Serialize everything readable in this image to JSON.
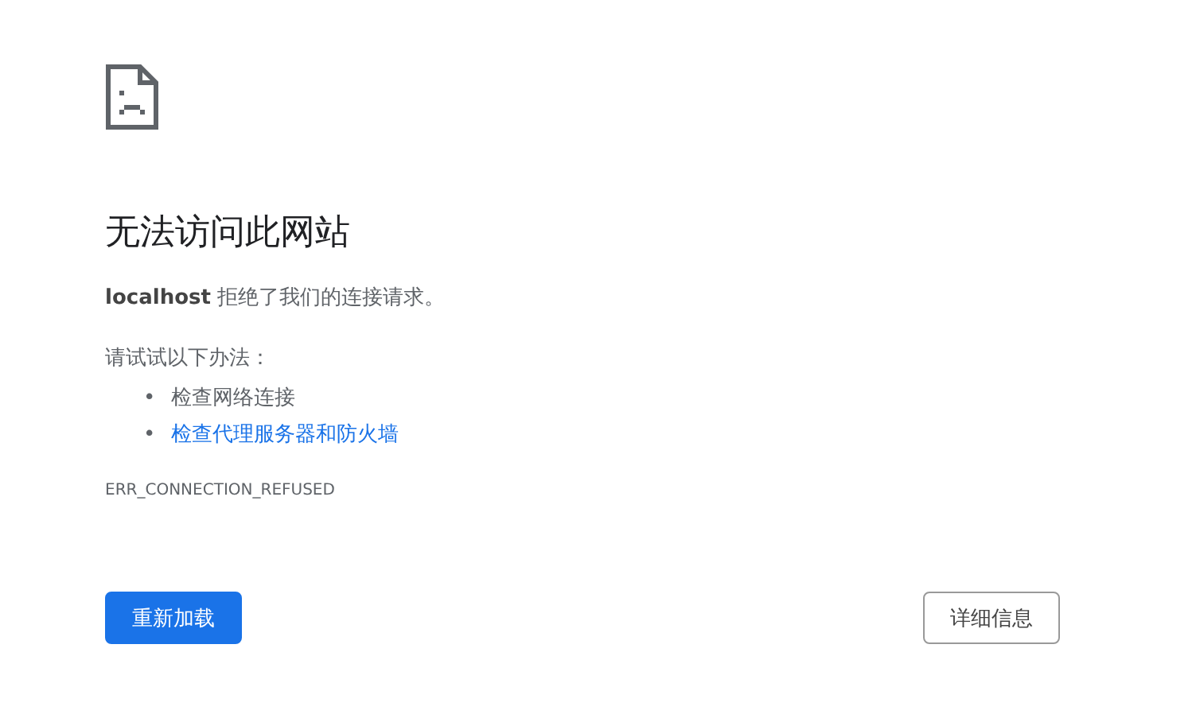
{
  "heading": "无法访问此网站",
  "message": "**localhost** 拒绝了我们的连接请求。",
  "suggestions_intro": "请试试以下办法：",
  "suggestions": [
    {
      "kind": "text",
      "bullet": "•",
      "label": "检查网络连接"
    },
    {
      "kind": "link",
      "bullet": "•",
      "label": "检查代理服务器和防火墙"
    }
  ],
  "error_code": "ERR_CONNECTION_REFUSED",
  "buttons": [
    {
      "kind": "primary",
      "label": "重新加载"
    },
    {
      "kind": "secondary",
      "label": "详细信息"
    }
  ]
}
